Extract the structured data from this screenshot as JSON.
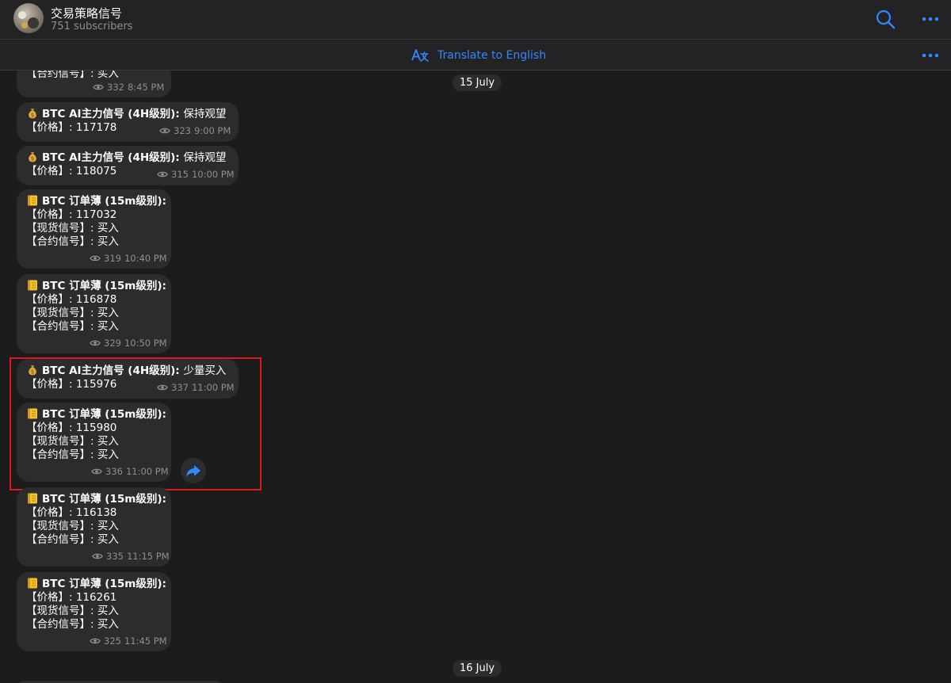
{
  "header": {
    "title": "交易策略信号",
    "subscribers": "751 subscribers",
    "search_icon": "search-icon",
    "more_icon": "more-icon"
  },
  "translate_bar": {
    "label": "Translate to English",
    "icon": "translate-icon"
  },
  "colors": {
    "background": "#1c1c1d",
    "bubble": "#2c2c2e",
    "accent": "#2f88ff",
    "meta_text": "#8e8e93",
    "highlight": "#e0161b"
  },
  "date_separators": [
    "15 July",
    "16 July"
  ],
  "messages": [
    {
      "lines": [
        "【合约信号】: 买入"
      ],
      "views": "332",
      "time": "8:45 PM"
    },
    {
      "emoji": "money-bag",
      "title": "BTC AI主力信号 (4H级别): ",
      "title_value": "保持观望",
      "lines": [
        "【价格】: 117178"
      ],
      "views": "323",
      "time": "9:00 PM"
    },
    {
      "emoji": "money-bag",
      "title": "BTC AI主力信号 (4H级别): ",
      "title_value": "保持观望",
      "lines": [
        "【价格】: 118075"
      ],
      "views": "315",
      "time": "10:00 PM"
    },
    {
      "emoji": "notebook",
      "title": "BTC 订单薄 (15m级别):",
      "lines": [
        "【价格】: 117032",
        "【现货信号】: 买入",
        "【合约信号】: 买入"
      ],
      "views": "319",
      "time": "10:40 PM"
    },
    {
      "emoji": "notebook",
      "title": "BTC 订单薄 (15m级别):",
      "lines": [
        "【价格】: 116878",
        "【现货信号】: 买入",
        "【合约信号】: 买入"
      ],
      "views": "329",
      "time": "10:50 PM"
    },
    {
      "emoji": "money-bag",
      "title": "BTC AI主力信号 (4H级别): ",
      "title_value": "少量买入",
      "lines": [
        "【价格】: 115976"
      ],
      "views": "337",
      "time": "11:00 PM"
    },
    {
      "emoji": "notebook",
      "title": "BTC 订单薄 (15m级别):",
      "lines": [
        "【价格】: 115980",
        "【现货信号】: 买入",
        "【合约信号】: 买入"
      ],
      "views": "336",
      "time": "11:00 PM"
    },
    {
      "emoji": "notebook",
      "title": "BTC 订单薄 (15m级别):",
      "lines": [
        "【价格】: 116138",
        "【现货信号】: 买入",
        "【合约信号】: 买入"
      ],
      "views": "335",
      "time": "11:15 PM"
    },
    {
      "emoji": "notebook",
      "title": "BTC 订单薄 (15m级别):",
      "lines": [
        "【价格】: 116261",
        "【现货信号】: 买入",
        "【合约信号】: 买入"
      ],
      "views": "325",
      "time": "11:45 PM"
    }
  ]
}
